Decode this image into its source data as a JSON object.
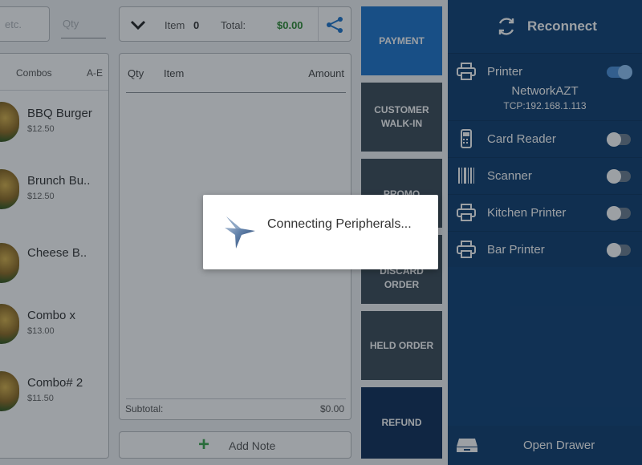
{
  "search": {
    "placeholder": "etc.",
    "qty_placeholder": "Qty"
  },
  "categories": {
    "combos_label": "Combos",
    "range_label": "A-E"
  },
  "products": [
    {
      "name": "BBQ Burger",
      "price": "$12.50"
    },
    {
      "name": "Brunch Bu..",
      "price": "$12.50"
    },
    {
      "name": "Cheese B..",
      "price": ""
    },
    {
      "name": "Combo x",
      "price": "$13.00"
    },
    {
      "name": "Combo# 2",
      "price": "$11.50"
    }
  ],
  "order_header": {
    "item_label": "Item",
    "item_count": "0",
    "total_label": "Total:",
    "total_value": "$0.00",
    "total_color": "#2e8b32"
  },
  "order_table": {
    "col_qty": "Qty",
    "col_item": "Item",
    "col_amount": "Amount",
    "subtotal_label": "Subtotal:",
    "subtotal_value": "$0.00"
  },
  "add_note": {
    "label": "Add Note"
  },
  "actions": {
    "payment": "PAYMENT",
    "customer": "CUSTOMER WALK-IN",
    "promo": "PROMO",
    "discard": "DISCARD ORDER",
    "held": "HELD ORDER",
    "refund": "REFUND"
  },
  "peripherals": {
    "reconnect_label": "Reconnect",
    "printer": {
      "label": "Printer",
      "device_name": "NetworkAZT",
      "address": "TCP:192.168.1.113",
      "enabled": true
    },
    "card_reader": {
      "label": "Card Reader",
      "enabled": false
    },
    "scanner": {
      "label": "Scanner",
      "enabled": false
    },
    "kitchen_printer": {
      "label": "Kitchen Printer",
      "enabled": false
    },
    "bar_printer": {
      "label": "Bar Printer",
      "enabled": false
    },
    "open_drawer_label": "Open Drawer"
  },
  "dialog": {
    "message": "Connecting Peripherals...",
    "icon": "star-logo-icon"
  },
  "colors": {
    "payment_button": "#1d74cc",
    "action_button": "#3b4a57",
    "refund_button": "#0f2e58",
    "peripheral_panel": "#0f4175"
  }
}
